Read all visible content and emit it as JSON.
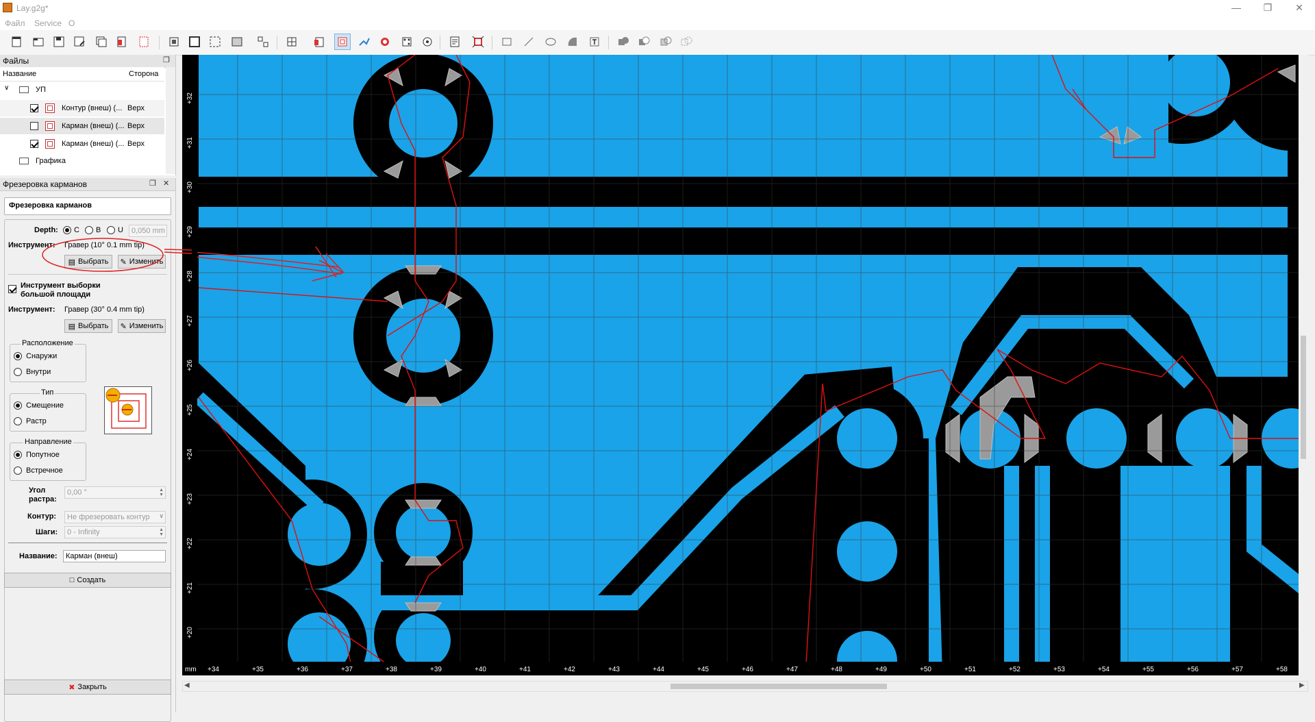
{
  "window": {
    "title": "Lay.g2g*"
  },
  "menu": [
    "Файл",
    "Service",
    "O"
  ],
  "files_panel": {
    "title": "Файлы",
    "col_name": "Название",
    "col_side": "Сторона",
    "root": "УП",
    "items": [
      {
        "name": "Контур (внеш) (...",
        "side": "Верх",
        "checked": true
      },
      {
        "name": "Карман (внеш) (...",
        "side": "Верх",
        "checked": false
      },
      {
        "name": "Карман (внеш) (...",
        "side": "Верх",
        "checked": true
      }
    ],
    "graphics": "Графика"
  },
  "op_panel": {
    "title": "Фрезеровка карманов",
    "header": "Фрезеровка карманов",
    "depth_label": "Depth:",
    "depth_opts": [
      "C",
      "B",
      "U"
    ],
    "depth_value": "0,050 mm",
    "tool_label": "Инструмент:",
    "tool_value": "Гравер (10° 0.1 mm tip)",
    "select_btn": "Выбрать",
    "edit_btn": "Изменить",
    "large_area_label_1": "Инструмент выборки",
    "large_area_label_2": "большой площади",
    "tool2_label": "Инструмент:",
    "tool2_value": "Гравер (30° 0.4 mm tip)",
    "select_btn2": "Выбрать",
    "edit_btn2": "Изменить",
    "location_title": "Расположение",
    "location_opts": [
      "Снаружи",
      "Внутри"
    ],
    "type_title": "Тип",
    "type_opts": [
      "Смещение",
      "Растр"
    ],
    "direction_title": "Направление",
    "direction_opts": [
      "Попутное",
      "Встречное"
    ],
    "raster_angle_label_1": "Угол",
    "raster_angle_label_2": "растра:",
    "raster_angle_value": "0,00 °",
    "contour_label": "Контур:",
    "contour_value": "Не фрезеровать контур",
    "steps_label": "Шаги:",
    "steps_value": "0 - Infinity",
    "name_label": "Название:",
    "name_value": "Карман (внеш)",
    "create_btn": "Создать",
    "close_btn": "Закрыть"
  },
  "ruler": {
    "unit": "mm",
    "x_ticks": [
      "+34",
      "+35",
      "+36",
      "+37",
      "+38",
      "+39",
      "+40",
      "+41",
      "+42",
      "+43",
      "+44",
      "+45",
      "+46",
      "+47",
      "+48",
      "+49",
      "+50",
      "+51",
      "+52",
      "+53",
      "+54",
      "+55",
      "+56",
      "+57",
      "+58"
    ],
    "y_ticks": [
      "+32",
      "+31",
      "+30",
      "+29",
      "+28",
      "+27",
      "+26",
      "+25",
      "+24",
      "+23",
      "+22",
      "+21",
      "+20"
    ]
  },
  "colors": {
    "copper": "#1aa3e8",
    "board": "#000000",
    "toolpath": "#e01010",
    "annotation": "#e02020"
  }
}
